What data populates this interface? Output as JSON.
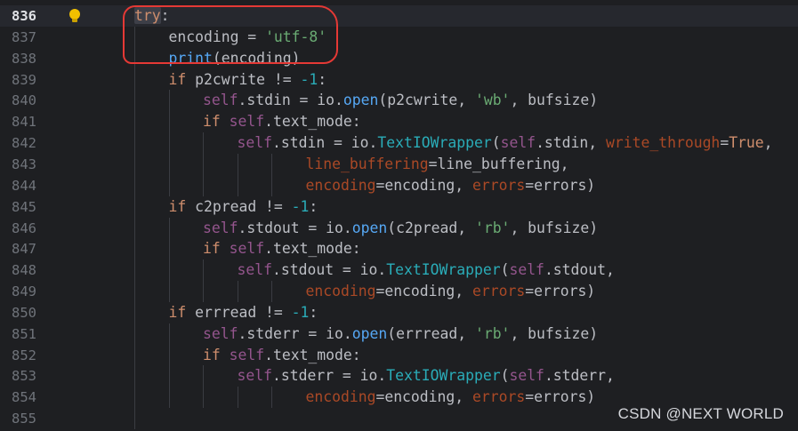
{
  "editor": {
    "colors": {
      "keyword": "#cf8e6d",
      "string": "#6aab73",
      "number": "#2aacb8",
      "function": "#56a8f5",
      "background": "#1e1f22",
      "annotation": "#e53935"
    },
    "gutter_icon": "lightbulb-icon",
    "lines": [
      {
        "num": "836",
        "indent": 0,
        "current": true,
        "tokens": [
          {
            "t": "try",
            "c": "kw tryhl"
          },
          {
            "t": ":"
          }
        ]
      },
      {
        "num": "837",
        "indent": 1,
        "tokens": [
          {
            "t": "encoding = "
          },
          {
            "t": "'utf-8'",
            "c": "str"
          }
        ]
      },
      {
        "num": "838",
        "indent": 1,
        "tokens": [
          {
            "t": "print",
            "c": "fn"
          },
          {
            "t": "(encoding)"
          }
        ]
      },
      {
        "num": "839",
        "indent": 1,
        "tokens": [
          {
            "t": "if ",
            "c": "kw"
          },
          {
            "t": "p2cwrite != "
          },
          {
            "t": "-1",
            "c": "num"
          },
          {
            "t": ":"
          }
        ]
      },
      {
        "num": "840",
        "indent": 2,
        "tokens": [
          {
            "t": "self",
            "c": "self"
          },
          {
            "t": ".stdin = io."
          },
          {
            "t": "open",
            "c": "fn"
          },
          {
            "t": "(p2cwrite, "
          },
          {
            "t": "'wb'",
            "c": "str"
          },
          {
            "t": ", bufsize)"
          }
        ]
      },
      {
        "num": "841",
        "indent": 2,
        "tokens": [
          {
            "t": "if ",
            "c": "kw"
          },
          {
            "t": "self",
            "c": "self"
          },
          {
            "t": ".text_mode:"
          }
        ]
      },
      {
        "num": "842",
        "indent": 3,
        "tokens": [
          {
            "t": "self",
            "c": "self"
          },
          {
            "t": ".stdin = io."
          },
          {
            "t": "TextIOWrapper",
            "c": "cls"
          },
          {
            "t": "("
          },
          {
            "t": "self",
            "c": "self"
          },
          {
            "t": ".stdin, "
          },
          {
            "t": "write_through",
            "c": "param"
          },
          {
            "t": "="
          },
          {
            "t": "True",
            "c": "kw"
          },
          {
            "t": ","
          }
        ]
      },
      {
        "num": "843",
        "indent": 5,
        "tokens": [
          {
            "t": "line_buffering",
            "c": "param"
          },
          {
            "t": "=line_buffering,"
          }
        ]
      },
      {
        "num": "844",
        "indent": 5,
        "tokens": [
          {
            "t": "encoding",
            "c": "param"
          },
          {
            "t": "=encoding, "
          },
          {
            "t": "errors",
            "c": "param"
          },
          {
            "t": "=errors)"
          }
        ]
      },
      {
        "num": "845",
        "indent": 1,
        "tokens": [
          {
            "t": "if ",
            "c": "kw"
          },
          {
            "t": "c2pread != "
          },
          {
            "t": "-1",
            "c": "num"
          },
          {
            "t": ":"
          }
        ]
      },
      {
        "num": "846",
        "indent": 2,
        "tokens": [
          {
            "t": "self",
            "c": "self"
          },
          {
            "t": ".stdout = io."
          },
          {
            "t": "open",
            "c": "fn"
          },
          {
            "t": "(c2pread, "
          },
          {
            "t": "'rb'",
            "c": "str"
          },
          {
            "t": ", bufsize)"
          }
        ]
      },
      {
        "num": "847",
        "indent": 2,
        "tokens": [
          {
            "t": "if ",
            "c": "kw"
          },
          {
            "t": "self",
            "c": "self"
          },
          {
            "t": ".text_mode:"
          }
        ]
      },
      {
        "num": "848",
        "indent": 3,
        "tokens": [
          {
            "t": "self",
            "c": "self"
          },
          {
            "t": ".stdout = io."
          },
          {
            "t": "TextIOWrapper",
            "c": "cls"
          },
          {
            "t": "("
          },
          {
            "t": "self",
            "c": "self"
          },
          {
            "t": ".stdout,"
          }
        ]
      },
      {
        "num": "849",
        "indent": 5,
        "tokens": [
          {
            "t": "encoding",
            "c": "param"
          },
          {
            "t": "=encoding, "
          },
          {
            "t": "errors",
            "c": "param"
          },
          {
            "t": "=errors)"
          }
        ]
      },
      {
        "num": "850",
        "indent": 1,
        "tokens": [
          {
            "t": "if ",
            "c": "kw"
          },
          {
            "t": "errread != "
          },
          {
            "t": "-1",
            "c": "num"
          },
          {
            "t": ":"
          }
        ]
      },
      {
        "num": "851",
        "indent": 2,
        "tokens": [
          {
            "t": "self",
            "c": "self"
          },
          {
            "t": ".stderr = io."
          },
          {
            "t": "open",
            "c": "fn"
          },
          {
            "t": "(errread, "
          },
          {
            "t": "'rb'",
            "c": "str"
          },
          {
            "t": ", bufsize)"
          }
        ]
      },
      {
        "num": "852",
        "indent": 2,
        "tokens": [
          {
            "t": "if ",
            "c": "kw"
          },
          {
            "t": "self",
            "c": "self"
          },
          {
            "t": ".text_mode:"
          }
        ]
      },
      {
        "num": "853",
        "indent": 3,
        "tokens": [
          {
            "t": "self",
            "c": "self"
          },
          {
            "t": ".stderr = io."
          },
          {
            "t": "TextIOWrapper",
            "c": "cls"
          },
          {
            "t": "("
          },
          {
            "t": "self",
            "c": "self"
          },
          {
            "t": ".stderr,"
          }
        ]
      },
      {
        "num": "854",
        "indent": 5,
        "tokens": [
          {
            "t": "encoding",
            "c": "param"
          },
          {
            "t": "=encoding, "
          },
          {
            "t": "errors",
            "c": "param"
          },
          {
            "t": "=errors)"
          }
        ]
      },
      {
        "num": "855",
        "indent": 0,
        "tokens": []
      }
    ]
  },
  "watermark": "CSDN @NEXT WORLD"
}
